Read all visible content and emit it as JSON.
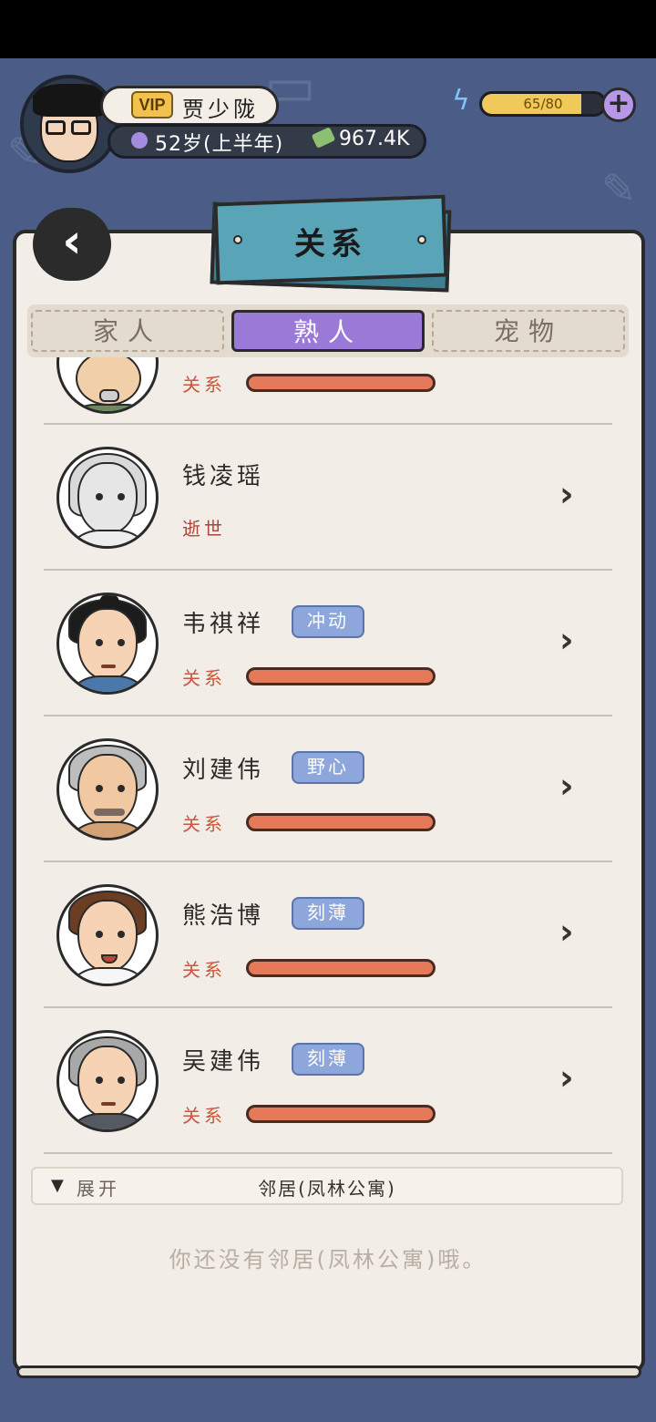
{
  "header": {
    "vip_label": "VIP",
    "player_name": "贾少陇",
    "age_text": "52岁(上半年)",
    "money_text": "967.4K",
    "energy_text": "65/80",
    "energy_fraction": 0.8125
  },
  "page": {
    "title": "关系",
    "tabs": [
      {
        "label": "家人"
      },
      {
        "label": "熟人"
      },
      {
        "label": "宠物"
      }
    ],
    "active_tab": "熟人"
  },
  "contacts": [
    {
      "name": "",
      "trait": "",
      "relation_label": "关系"
    },
    {
      "name": "钱凌瑶",
      "status": "逝世"
    },
    {
      "name": "韦祺祥",
      "trait": "冲动",
      "relation_label": "关系"
    },
    {
      "name": "刘建伟",
      "trait": "野心",
      "relation_label": "关系"
    },
    {
      "name": "熊浩博",
      "trait": "刻薄",
      "relation_label": "关系"
    },
    {
      "name": "吴建伟",
      "trait": "刻薄",
      "relation_label": "关系"
    }
  ],
  "neighbors": {
    "expand_label": "展开",
    "section_title": "邻居(凤林公寓)",
    "empty_message": "你还没有邻居(凤林公寓)哦。"
  },
  "icons": {
    "back": "chevron-left-icon",
    "energy": "lightning-icon",
    "add": "plus-icon",
    "age": "clock-icon",
    "money": "money-icon",
    "row_arrow": "chevron-right-icon"
  },
  "colors": {
    "background": "#4b5d87",
    "panel": "#f2ede6",
    "tab_active": "#9b79d6",
    "trait_badge": "#8da7dc",
    "relation_bar": "#e57a5a",
    "title_banner": "#5aa4b8"
  }
}
